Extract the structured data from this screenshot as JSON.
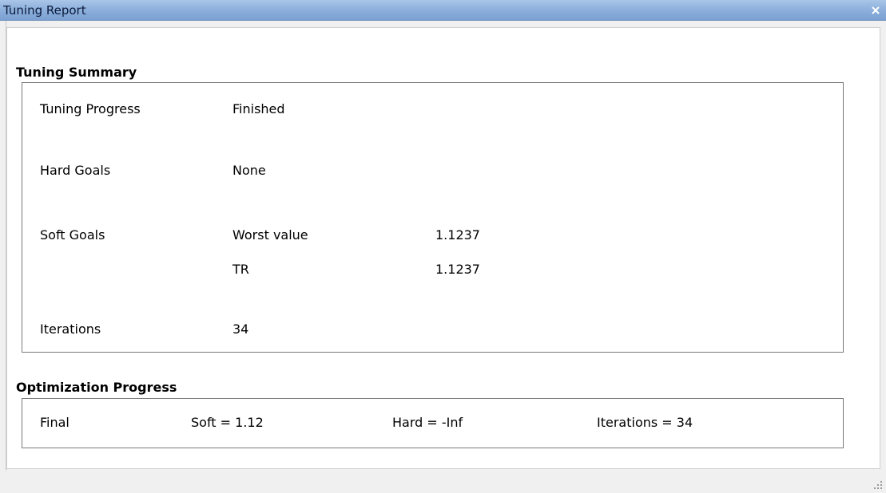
{
  "window": {
    "title": "Tuning Report",
    "close_icon": "close-icon"
  },
  "summary": {
    "title": "Tuning Summary",
    "progress_label": "Tuning Progress",
    "progress_value": "Finished",
    "hard_goals_label": "Hard Goals",
    "hard_goals_value": "None",
    "soft_goals_label": "Soft Goals",
    "soft_goals_rows": [
      {
        "name": "Worst value",
        "value": "1.1237"
      },
      {
        "name": "TR",
        "value": "1.1237"
      }
    ],
    "iterations_label": "Iterations",
    "iterations_value": "34"
  },
  "optimization": {
    "title": "Optimization Progress",
    "row_label": "Final",
    "soft": "Soft = 1.12",
    "hard": "Hard = -Inf",
    "iterations": "Iterations = 34"
  },
  "statusbar": {
    "grip_icon": "resize-grip-icon"
  }
}
